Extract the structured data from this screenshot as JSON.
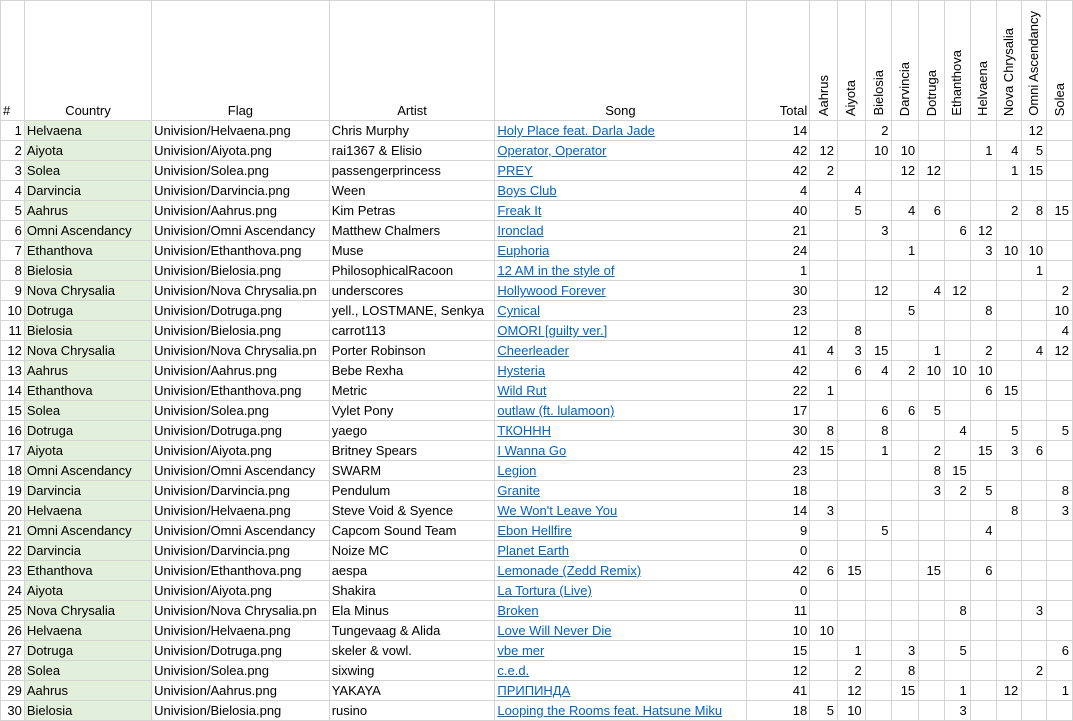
{
  "headers": {
    "num": "#",
    "country": "Country",
    "flag": "Flag",
    "artist": "Artist",
    "song": "Song",
    "total": "Total",
    "voters": [
      "Aahrus",
      "Aiyota",
      "Bielosia",
      "Darvincia",
      "Dotruga",
      "Ethanthova",
      "Helvaena",
      "Nova Chrysalia",
      "Omni Ascendancy",
      "Solea"
    ]
  },
  "rows": [
    {
      "n": "1",
      "country": "Helvaena",
      "flag": "Univision/Helvaena.png",
      "artist": "Chris Murphy",
      "song": "Holy Place feat. Darla Jade",
      "total": "14",
      "scores": [
        "",
        "",
        "2",
        "",
        "",
        "",
        "",
        "",
        "12",
        ""
      ]
    },
    {
      "n": "2",
      "country": "Aiyota",
      "flag": "Univision/Aiyota.png",
      "artist": "rai1367 & Elisio",
      "song": "Operator, Operator",
      "total": "42",
      "scores": [
        "12",
        "",
        "10",
        "10",
        "",
        "",
        "1",
        "4",
        "5",
        ""
      ]
    },
    {
      "n": "3",
      "country": "Solea",
      "flag": "Univision/Solea.png",
      "artist": "passengerprincess",
      "song": "PREY",
      "total": "42",
      "scores": [
        "2",
        "",
        "",
        "12",
        "12",
        "",
        "",
        "1",
        "15",
        ""
      ]
    },
    {
      "n": "4",
      "country": "Darvincia",
      "flag": "Univision/Darvincia.png",
      "artist": "Ween",
      "song": "Boys Club",
      "total": "4",
      "scores": [
        "",
        "4",
        "",
        "",
        "",
        "",
        "",
        "",
        "",
        ""
      ]
    },
    {
      "n": "5",
      "country": "Aahrus",
      "flag": "Univision/Aahrus.png",
      "artist": "Kim Petras",
      "song": "Freak It",
      "total": "40",
      "scores": [
        "",
        "5",
        "",
        "4",
        "6",
        "",
        "",
        "2",
        "8",
        "15"
      ]
    },
    {
      "n": "6",
      "country": "Omni Ascendancy",
      "flag": "Univision/Omni Ascendancy",
      "artist": "Matthew Chalmers",
      "song": "Ironclad",
      "total": "21",
      "scores": [
        "",
        "",
        "3",
        "",
        "",
        "6",
        "12",
        "",
        "",
        ""
      ]
    },
    {
      "n": "7",
      "country": "Ethanthova",
      "flag": "Univision/Ethanthova.png",
      "artist": "Muse",
      "song": "Euphoria",
      "total": "24",
      "scores": [
        "",
        "",
        "",
        "1",
        "",
        "",
        "3",
        "10",
        "10",
        ""
      ]
    },
    {
      "n": "8",
      "country": "Bielosia",
      "flag": "Univision/Bielosia.png",
      "artist": "PhilosophicalRacoon",
      "song": "12 AM in the style of",
      "total": "1",
      "scores": [
        "",
        "",
        "",
        "",
        "",
        "",
        "",
        "",
        "1",
        ""
      ]
    },
    {
      "n": "9",
      "country": "Nova Chrysalia",
      "flag": "Univision/Nova Chrysalia.pn",
      "artist": "underscores",
      "song": "Hollywood Forever",
      "total": "30",
      "scores": [
        "",
        "",
        "12",
        "",
        "4",
        "12",
        "",
        "",
        "",
        "2"
      ]
    },
    {
      "n": "10",
      "country": "Dotruga",
      "flag": "Univision/Dotruga.png",
      "artist": "yell., LOSTMANE, Senkya",
      "song": "Cynical",
      "total": "23",
      "scores": [
        "",
        "",
        "",
        "5",
        "",
        "",
        "8",
        "",
        "",
        "10"
      ]
    },
    {
      "n": "11",
      "country": "Bielosia",
      "flag": "Univision/Bielosia.png",
      "artist": "carrot113",
      "song": "OMORI [guilty ver.]",
      "total": "12",
      "scores": [
        "",
        "8",
        "",
        "",
        "",
        "",
        "",
        "",
        "",
        "4"
      ]
    },
    {
      "n": "12",
      "country": "Nova Chrysalia",
      "flag": "Univision/Nova Chrysalia.pn",
      "artist": "Porter Robinson",
      "song": "Cheerleader",
      "total": "41",
      "scores": [
        "4",
        "3",
        "15",
        "",
        "1",
        "",
        "2",
        "",
        "4",
        "12"
      ]
    },
    {
      "n": "13",
      "country": "Aahrus",
      "flag": "Univision/Aahrus.png",
      "artist": "Bebe Rexha",
      "song": "Hysteria",
      "total": "42",
      "scores": [
        "",
        "6",
        "4",
        "2",
        "10",
        "10",
        "10",
        "",
        "",
        ""
      ]
    },
    {
      "n": "14",
      "country": "Ethanthova",
      "flag": "Univision/Ethanthova.png",
      "artist": "Metric",
      "song": "Wild Rut",
      "total": "22",
      "scores": [
        "1",
        "",
        "",
        "",
        "",
        "",
        "6",
        "15",
        "",
        ""
      ]
    },
    {
      "n": "15",
      "country": "Solea",
      "flag": "Univision/Solea.png",
      "artist": "Vylet Pony",
      "song": "outlaw (ft. lulamoon)",
      "total": "17",
      "scores": [
        "",
        "",
        "6",
        "6",
        "5",
        "",
        "",
        "",
        "",
        ""
      ]
    },
    {
      "n": "16",
      "country": "Dotruga",
      "flag": "Univision/Dotruga.png",
      "artist": "yaego",
      "song": "ТКОННН",
      "total": "30",
      "scores": [
        "8",
        "",
        "8",
        "",
        "",
        "4",
        "",
        "5",
        "",
        "5"
      ]
    },
    {
      "n": "17",
      "country": "Aiyota",
      "flag": "Univision/Aiyota.png",
      "artist": "Britney Spears",
      "song": "I Wanna Go",
      "total": "42",
      "scores": [
        "15",
        "",
        "1",
        "",
        "2",
        "",
        "15",
        "3",
        "6",
        ""
      ]
    },
    {
      "n": "18",
      "country": "Omni Ascendancy",
      "flag": "Univision/Omni Ascendancy",
      "artist": "SWARM",
      "song": "Legion",
      "total": "23",
      "scores": [
        "",
        "",
        "",
        "",
        "8",
        "15",
        "",
        "",
        "",
        ""
      ]
    },
    {
      "n": "19",
      "country": "Darvincia",
      "flag": "Univision/Darvincia.png",
      "artist": "Pendulum",
      "song": "Granite",
      "total": "18",
      "scores": [
        "",
        "",
        "",
        "",
        "3",
        "2",
        "5",
        "",
        "",
        "8"
      ]
    },
    {
      "n": "20",
      "country": "Helvaena",
      "flag": "Univision/Helvaena.png",
      "artist": "Steve Void & Syence",
      "song": "We Won't Leave You",
      "total": "14",
      "scores": [
        "3",
        "",
        "",
        "",
        "",
        "",
        "",
        "8",
        "",
        "3"
      ]
    },
    {
      "n": "21",
      "country": "Omni Ascendancy",
      "flag": "Univision/Omni Ascendancy",
      "artist": "Capcom Sound Team",
      "song": "Ebon Hellfire",
      "total": "9",
      "scores": [
        "",
        "",
        "5",
        "",
        "",
        "",
        "4",
        "",
        "",
        ""
      ]
    },
    {
      "n": "22",
      "country": "Darvincia",
      "flag": "Univision/Darvincia.png",
      "artist": "Noize MC",
      "song": "Planet Earth",
      "total": "0",
      "scores": [
        "",
        "",
        "",
        "",
        "",
        "",
        "",
        "",
        "",
        ""
      ]
    },
    {
      "n": "23",
      "country": "Ethanthova",
      "flag": "Univision/Ethanthova.png",
      "artist": "aespa",
      "song": "Lemonade (Zedd Remix)",
      "total": "42",
      "scores": [
        "6",
        "15",
        "",
        "",
        "15",
        "",
        "6",
        "",
        "",
        ""
      ]
    },
    {
      "n": "24",
      "country": "Aiyota",
      "flag": "Univision/Aiyota.png",
      "artist": "Shakira",
      "song": "La Tortura (Live)",
      "total": "0",
      "scores": [
        "",
        "",
        "",
        "",
        "",
        "",
        "",
        "",
        "",
        ""
      ]
    },
    {
      "n": "25",
      "country": "Nova Chrysalia",
      "flag": "Univision/Nova Chrysalia.pn",
      "artist": "Ela Minus",
      "song": "Broken",
      "total": "11",
      "scores": [
        "",
        "",
        "",
        "",
        "",
        "8",
        "",
        "",
        "3",
        ""
      ]
    },
    {
      "n": "26",
      "country": "Helvaena",
      "flag": "Univision/Helvaena.png",
      "artist": "Tungevaag & Alida",
      "song": "Love Will Never Die",
      "total": "10",
      "scores": [
        "10",
        "",
        "",
        "",
        "",
        "",
        "",
        "",
        "",
        ""
      ]
    },
    {
      "n": "27",
      "country": "Dotruga",
      "flag": "Univision/Dotruga.png",
      "artist": "skeler & vowl.",
      "song": "vbe mer",
      "total": "15",
      "scores": [
        "",
        "1",
        "",
        "3",
        "",
        "5",
        "",
        "",
        "",
        "6"
      ]
    },
    {
      "n": "28",
      "country": "Solea",
      "flag": "Univision/Solea.png",
      "artist": "sixwing",
      "song": "c.e.d.",
      "total": "12",
      "scores": [
        "",
        "2",
        "",
        "8",
        "",
        "",
        "",
        "",
        "2",
        ""
      ]
    },
    {
      "n": "29",
      "country": "Aahrus",
      "flag": "Univision/Aahrus.png",
      "artist": "YAKAYA",
      "song": "ПРИПИНДА",
      "total": "41",
      "scores": [
        "",
        "12",
        "",
        "15",
        "",
        "1",
        "",
        "12",
        "",
        "1"
      ]
    },
    {
      "n": "30",
      "country": "Bielosia",
      "flag": "Univision/Bielosia.png",
      "artist": "rusino",
      "song": "Looping the Rooms feat. Hatsune Miku",
      "total": "18",
      "scores": [
        "5",
        "10",
        "",
        "",
        "",
        "3",
        "",
        "",
        "",
        ""
      ]
    }
  ]
}
